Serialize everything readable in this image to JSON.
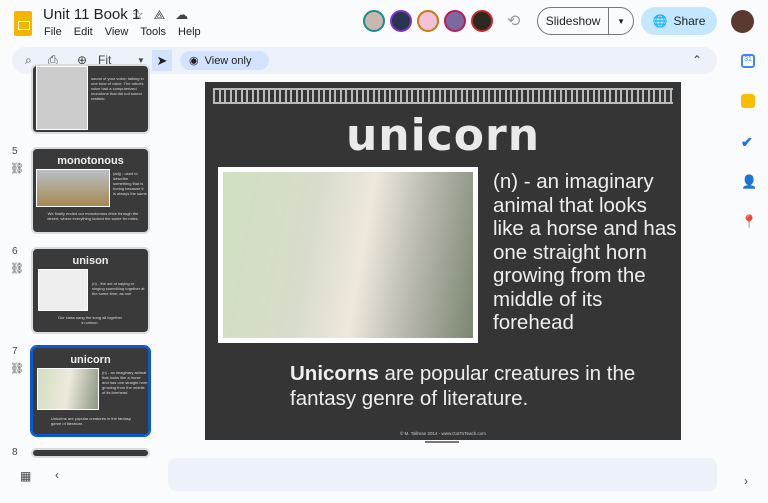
{
  "header": {
    "title": "Unit 11 Book 1",
    "menu": [
      "File",
      "Edit",
      "View",
      "Tools",
      "Help"
    ],
    "slideshow_label": "Slideshow",
    "share_label": "Share"
  },
  "toolbar": {
    "zoom_value": "Fit",
    "view_only_label": "View only"
  },
  "filmstrip": [
    {
      "number": "",
      "title": "",
      "body": "sound of your voice; talking in one tone of voice. The robot's voice had a computerized monotone that did not sound realistic."
    },
    {
      "number": "5",
      "title": "monotonous",
      "definition": "(adj) - used to describe something that is boring because it is always the same",
      "example": "We finally ended our monotonous drive through the desert, where everything looked the same for miles."
    },
    {
      "number": "6",
      "title": "unison",
      "definition": "(n) - the act of saying or singing something together at the same time; as one",
      "example": "Our class sang the song all together in unison."
    },
    {
      "number": "7",
      "title": "unicorn",
      "definition": "(n) - an imaginary animal that looks like a horse and has one straight horn growing from the middle of its forehead",
      "example": "Unicorns are popular creatures in the fantasy genre of literature."
    },
    {
      "number": "8"
    }
  ],
  "slide": {
    "title": "unicorn",
    "definition": "(n) - an imaginary animal that looks like a horse and has one straight horn growing from the middle of its forehead",
    "example_bold": "Unicorns",
    "example_rest": " are popular creatures in the fantasy genre of literature.",
    "footer": "© M. Tallman 2014 - www.GotToTeach.com"
  },
  "colors": {
    "accent": "#0b57d0",
    "share_bg": "#c2e7ff",
    "slide_bg": "#353535"
  }
}
